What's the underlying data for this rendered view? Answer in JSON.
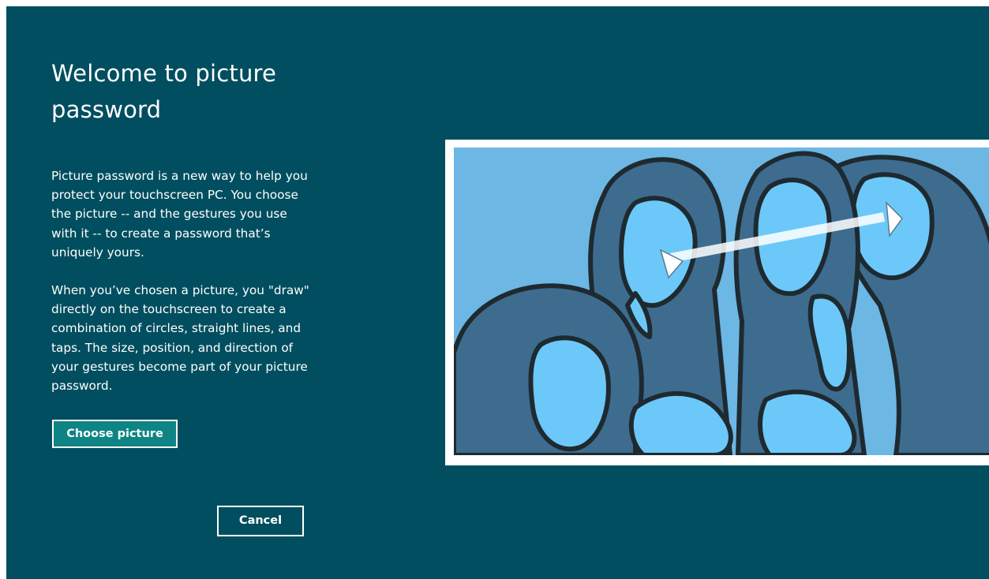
{
  "screen": {
    "title": "Welcome to picture password",
    "paragraphs": [
      "Picture password is a new way to help you protect your touchscreen PC. You choose the picture -- and the gestures you use with it -- to create a password that’s uniquely yours.",
      "When you’ve chosen a picture, you \"draw\" directly on the touchscreen to create a combination of circles, straight lines, and taps. The size, position, and direction of your gestures become part of your picture password."
    ],
    "choose_picture_label": "Choose picture",
    "cancel_label": "Cancel"
  },
  "illustration": {
    "subject": "four-children-illustration",
    "gesture": "straight-line-arrow"
  },
  "colors": {
    "background": "#004e5f",
    "choose_button": "#0e8584",
    "text": "#ffffff",
    "sky": "#6cb7e4",
    "skin": "#6cc8f8",
    "hair": "#3d6c8f",
    "outline": "#1e2a30"
  }
}
